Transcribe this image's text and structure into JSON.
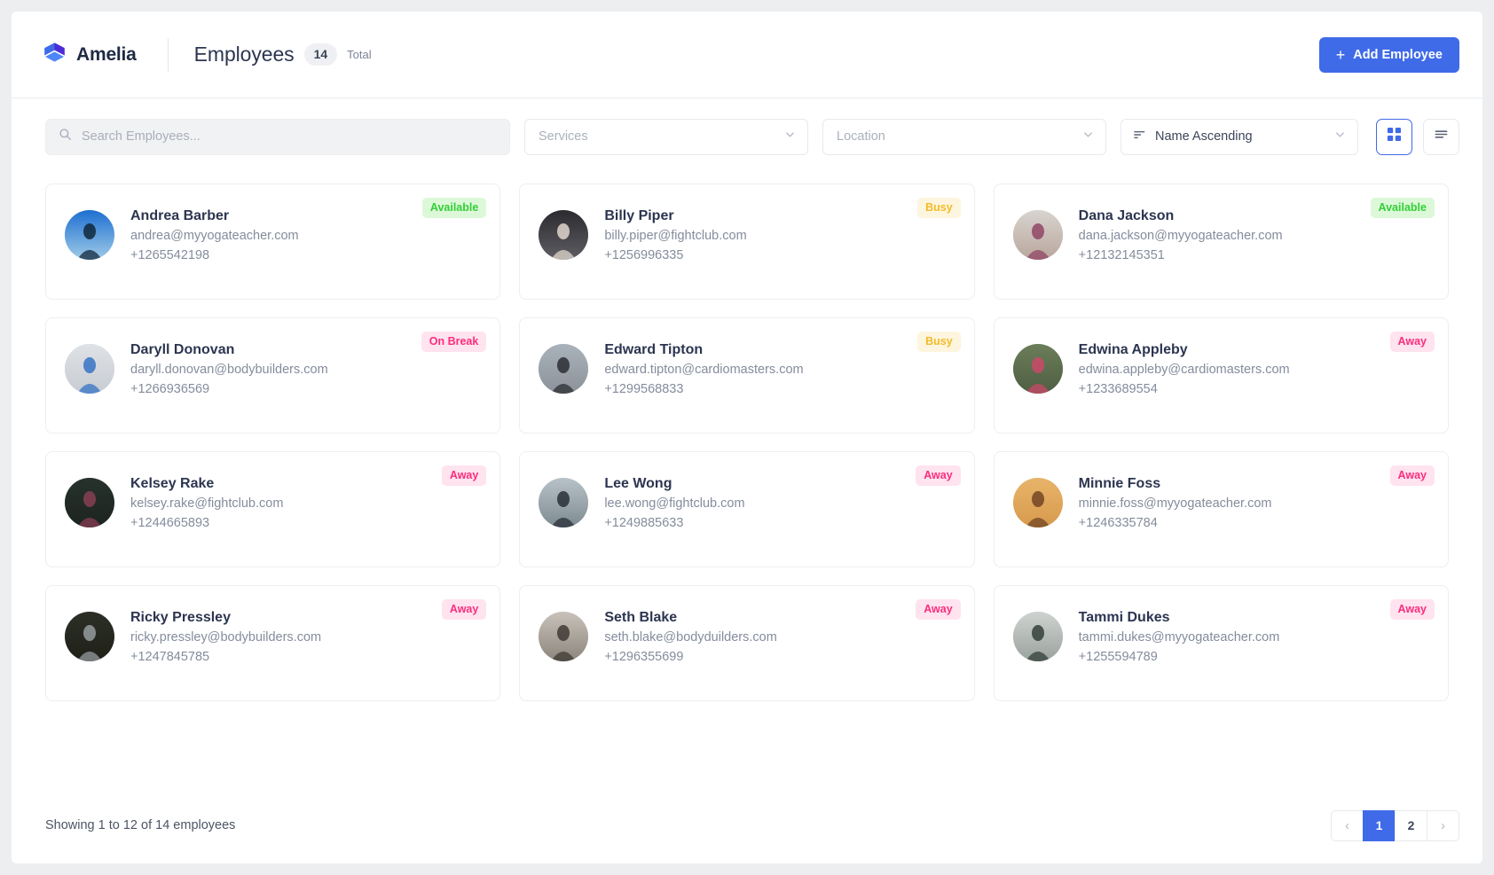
{
  "header": {
    "brand_name": "Amelia",
    "logo_icon": "cube-logo-icon",
    "page_title": "Employees",
    "count": "14",
    "count_label": "Total",
    "add_button": "Add Employee",
    "add_icon": "plus-icon"
  },
  "filters": {
    "search_placeholder": "Search Employees...",
    "search_value": "",
    "search_icon": "search-icon",
    "services_label": "Services",
    "location_label": "Location",
    "sort_label": "Name Ascending",
    "sort_icon": "sort-ascending-icon",
    "chevron_icon": "chevron-down-icon",
    "grid_view_icon": "grid-view-icon",
    "list_view_icon": "list-view-icon",
    "active_view": "grid"
  },
  "colors": {
    "accent": "#3f6ae8",
    "available_bg": "#ddf8d8",
    "available_text": "#32d037",
    "busy_bg": "#fdf5dd",
    "busy_text": "#f3bb2a",
    "pink_bg": "#ffe3ef",
    "pink_text": "#fb2e7e"
  },
  "employees": [
    {
      "name": "Andrea Barber",
      "email": "andrea@myyogateacher.com",
      "phone": "+1265542198",
      "status": "Available",
      "status_class": "st-available",
      "avatar": {
        "top": "#1d6fd0",
        "bottom": "#9fcbe8",
        "subject": "#0e2236"
      }
    },
    {
      "name": "Billy Piper",
      "email": "billy.piper@fightclub.com",
      "phone": "+1256996335",
      "status": "Busy",
      "status_class": "st-busy",
      "avatar": {
        "top": "#2b2b2f",
        "bottom": "#5d5d63",
        "subject": "#e6dcd2"
      }
    },
    {
      "name": "Dana Jackson",
      "email": "dana.jackson@myyogateacher.com",
      "phone": "+12132145351",
      "status": "Available",
      "status_class": "st-available",
      "avatar": {
        "top": "#d8d4cf",
        "bottom": "#b9a79d",
        "subject": "#8f4163"
      }
    },
    {
      "name": "Daryll Donovan",
      "email": "daryll.donovan@bodybuilders.com",
      "phone": "+1266936569",
      "status": "On Break",
      "status_class": "st-onbreak",
      "avatar": {
        "top": "#dfe2e6",
        "bottom": "#c7ccd2",
        "subject": "#2f6fc4"
      }
    },
    {
      "name": "Edward Tipton",
      "email": "edward.tipton@cardiomasters.com",
      "phone": "+1299568833",
      "status": "Busy",
      "status_class": "st-busy",
      "avatar": {
        "top": "#a9b2bb",
        "bottom": "#8d9299",
        "subject": "#27292e"
      }
    },
    {
      "name": "Edwina Appleby",
      "email": "edwina.appleby@cardiomasters.com",
      "phone": "+1233689554",
      "status": "Away",
      "status_class": "st-away",
      "avatar": {
        "top": "#6b7d5a",
        "bottom": "#4f5f42",
        "subject": "#d0476a"
      }
    },
    {
      "name": "Kelsey Rake",
      "email": "kelsey.rake@fightclub.com",
      "phone": "+1244665893",
      "status": "Away",
      "status_class": "st-away",
      "avatar": {
        "top": "#27322c",
        "bottom": "#1c2420",
        "subject": "#8b3f55"
      }
    },
    {
      "name": "Lee Wong",
      "email": "lee.wong@fightclub.com",
      "phone": "+1249885633",
      "status": "Away",
      "status_class": "st-away",
      "avatar": {
        "top": "#b8c3c9",
        "bottom": "#7d8a91",
        "subject": "#262b33"
      }
    },
    {
      "name": "Minnie Foss",
      "email": "minnie.foss@myyogateacher.com",
      "phone": "+1246335784",
      "status": "Away",
      "status_class": "st-away",
      "avatar": {
        "top": "#e8b46a",
        "bottom": "#d79a4d",
        "subject": "#6e4222"
      }
    },
    {
      "name": "Ricky Pressley",
      "email": "ricky.pressley@bodybuilders.com",
      "phone": "+1247845785",
      "status": "Away",
      "status_class": "st-away",
      "avatar": {
        "top": "#2c2f26",
        "bottom": "#1f2119",
        "subject": "#9aa0a4"
      }
    },
    {
      "name": "Seth Blake",
      "email": "seth.blake@bodyduilders.com",
      "phone": "+1296355699",
      "status": "Away",
      "status_class": "st-away",
      "avatar": {
        "top": "#c8c2ba",
        "bottom": "#8d857c",
        "subject": "#3a3630"
      }
    },
    {
      "name": "Tammi Dukes",
      "email": "tammi.dukes@myyogateacher.com",
      "phone": "+1255594789",
      "status": "Away",
      "status_class": "st-away",
      "avatar": {
        "top": "#cfd3d0",
        "bottom": "#9aa39d",
        "subject": "#2e3a34"
      }
    }
  ],
  "footer": {
    "showing_text": "Showing 1 to 12 of 14 employees",
    "prev_label": "‹",
    "next_label": "›",
    "pages": [
      "1",
      "2"
    ],
    "active_page": "1"
  }
}
